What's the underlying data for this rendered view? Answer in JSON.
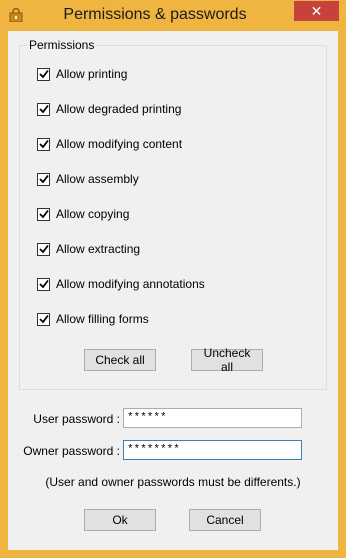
{
  "window": {
    "title": "Permissions & passwords",
    "close_glyph": "✕"
  },
  "permissions": {
    "legend": "Permissions",
    "items": [
      {
        "label": "Allow printing",
        "checked": true
      },
      {
        "label": "Allow degraded printing",
        "checked": true
      },
      {
        "label": "Allow modifying content",
        "checked": true
      },
      {
        "label": "Allow assembly",
        "checked": true
      },
      {
        "label": "Allow copying",
        "checked": true
      },
      {
        "label": "Allow extracting",
        "checked": true
      },
      {
        "label": "Allow modifying annotations",
        "checked": true
      },
      {
        "label": "Allow filling forms",
        "checked": true
      }
    ],
    "check_all_label": "Check all",
    "uncheck_all_label": "Uncheck all"
  },
  "passwords": {
    "user_label": "User password :",
    "user_value": "******",
    "owner_label": "Owner password :",
    "owner_value": "********",
    "note": "(User and owner passwords must be differents.)"
  },
  "footer": {
    "ok_label": "Ok",
    "cancel_label": "Cancel"
  },
  "colors": {
    "titlebar": "#f0b541",
    "close": "#c7423a",
    "client": "#f0f0f0"
  },
  "icons": {
    "app": "lock-icon",
    "check": "checkmark-icon",
    "close": "close-icon"
  }
}
